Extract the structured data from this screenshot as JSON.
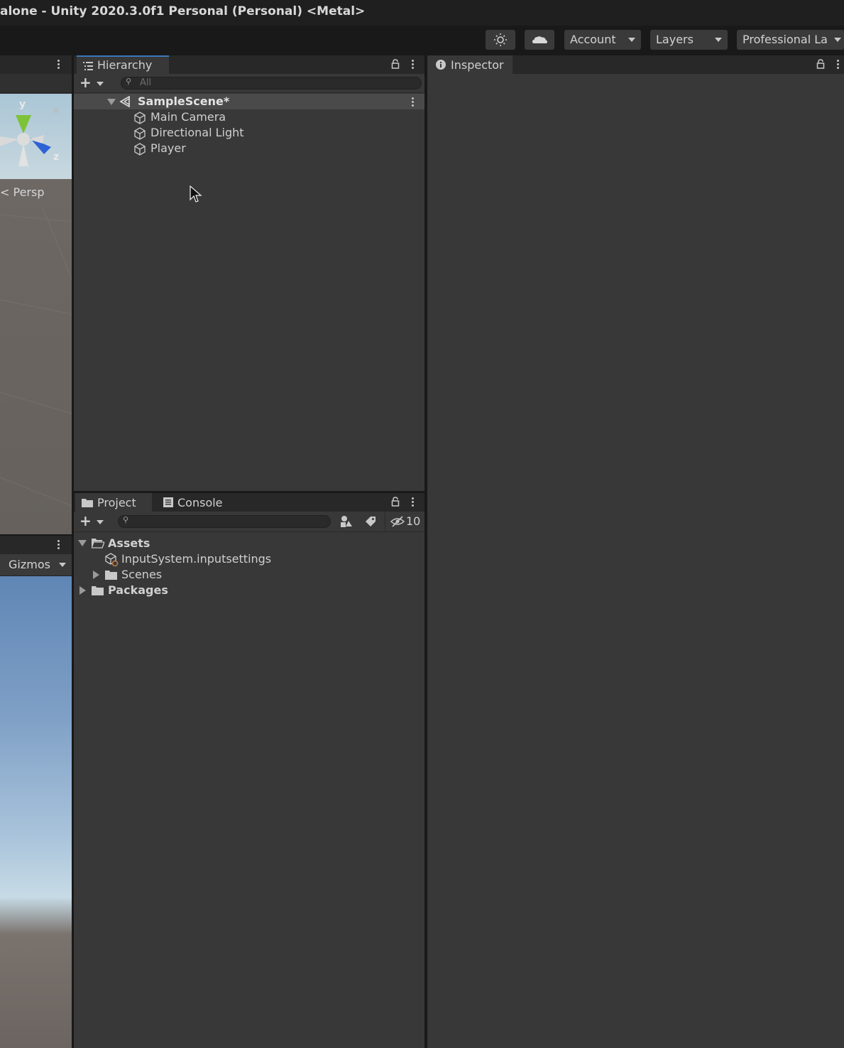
{
  "window": {
    "title": "alone - Unity 2020.3.0f1 Personal (Personal) <Metal>"
  },
  "toolbar": {
    "account_label": "Account",
    "layers_label": "Layers",
    "layout_label": "Professional La",
    "icons": [
      "sun-icon",
      "cloud-icon"
    ]
  },
  "scene": {
    "axis_y": "y",
    "axis_z": "z",
    "persp_label": "Persp"
  },
  "game": {
    "gizmos_label": "Gizmos"
  },
  "hierarchy": {
    "tab_label": "Hierarchy",
    "search_placeholder": "All",
    "scene_name": "SampleScene*",
    "objects": [
      "Main Camera",
      "Directional Light",
      "Player"
    ]
  },
  "project": {
    "tabs": [
      "Project",
      "Console"
    ],
    "hidden_count": "10",
    "tree": {
      "assets": "Assets",
      "input_settings": "InputSystem.inputsettings",
      "scenes": "Scenes",
      "packages": "Packages"
    }
  },
  "inspector": {
    "tab_label": "Inspector"
  },
  "colors": {
    "panel_bg": "#383838",
    "tab_bar_bg": "#282828",
    "window_bg": "#191919",
    "active_tab_accent": "#3a79bb",
    "text": "#d0d0d0"
  }
}
